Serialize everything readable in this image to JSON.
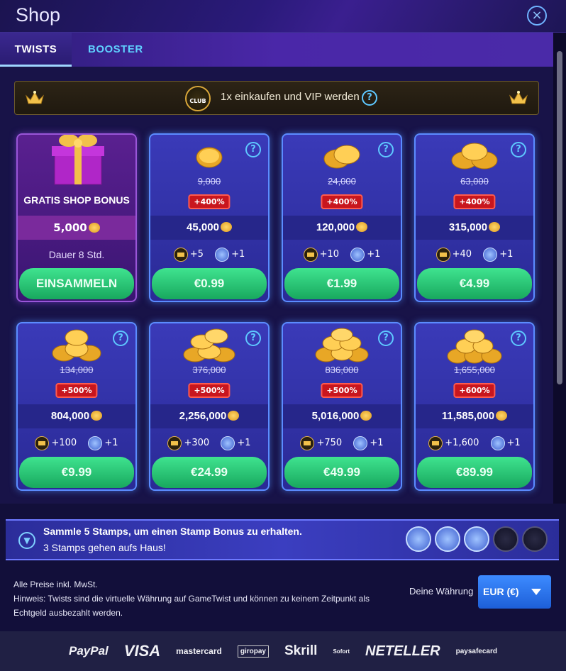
{
  "header": {
    "title": "Shop",
    "close_symbol": "×"
  },
  "tabs": [
    {
      "label": "TWISTS",
      "active": true
    },
    {
      "label": "BOOSTER",
      "active": false
    }
  ],
  "vip_banner": {
    "badge": "CLUB",
    "text": "1x einkaufen und VIP werden",
    "help": "?"
  },
  "gratis_card": {
    "title": "GRATIS SHOP BONUS",
    "amount": "5,000",
    "duration": "Dauer 8 Std.",
    "button": "EINSAMMELN"
  },
  "cards": [
    {
      "old": "9,000",
      "bonus": "+400%",
      "amount": "45,000",
      "crowns": "+5",
      "stamps": "+1",
      "price": "€0.99"
    },
    {
      "old": "24,000",
      "bonus": "+400%",
      "amount": "120,000",
      "crowns": "+10",
      "stamps": "+1",
      "price": "€1.99"
    },
    {
      "old": "63,000",
      "bonus": "+400%",
      "amount": "315,000",
      "crowns": "+40",
      "stamps": "+1",
      "price": "€4.99"
    },
    {
      "old": "134,000",
      "bonus": "+500%",
      "amount": "804,000",
      "crowns": "+100",
      "stamps": "+1",
      "price": "€9.99"
    },
    {
      "old": "376,000",
      "bonus": "+500%",
      "amount": "2,256,000",
      "crowns": "+300",
      "stamps": "+1",
      "price": "€24.99"
    },
    {
      "old": "836,000",
      "bonus": "+500%",
      "amount": "5,016,000",
      "crowns": "+750",
      "stamps": "+1",
      "price": "€49.99"
    },
    {
      "old": "1,655,000",
      "bonus": "+600%",
      "amount": "11,585,000",
      "crowns": "+1,600",
      "stamps": "+1",
      "price": "€89.99"
    }
  ],
  "stamp_banner": {
    "title": "Sammle 5 Stamps, um einen Stamp Bonus zu erhalten.",
    "subtitle": "3 Stamps gehen aufs Haus!",
    "filled": 3,
    "total": 5
  },
  "info": {
    "line1": "Alle Preise inkl. MwSt.",
    "line2": "Hinweis: Twists sind die virtuelle Währung auf GameTwist und können zu keinem Zeitpunkt als",
    "line3": "Echtgeld ausbezahlt werden."
  },
  "currency": {
    "label": "Deine Währung",
    "value": "EUR (€)"
  },
  "payments": [
    "PayPal",
    "VISA",
    "mastercard",
    "giropay",
    "Skrill",
    "Sofort",
    "NETELLER",
    "paysafecard"
  ],
  "colors": {
    "accent": "#5ec8ff",
    "buy_button": "#2fcf7f",
    "bonus_badge": "#c8161e"
  }
}
